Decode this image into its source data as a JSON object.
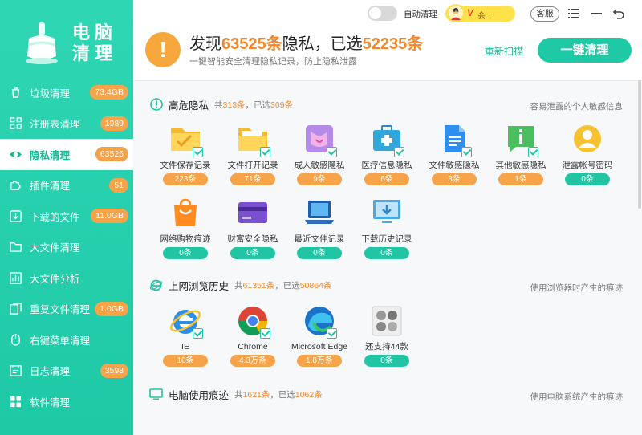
{
  "app": {
    "logo_text_1": "电脑",
    "logo_text_2": "清理"
  },
  "sidebar": {
    "items": [
      {
        "label": "垃圾清理",
        "badge": "73.4GB",
        "icon": "trash-icon"
      },
      {
        "label": "注册表清理",
        "badge": "1989",
        "icon": "registry-grid-icon"
      },
      {
        "label": "隐私清理",
        "badge": "63525",
        "icon": "eye-privacy-icon",
        "active": true
      },
      {
        "label": "插件清理",
        "badge": "51",
        "icon": "puzzle-plugin-icon"
      },
      {
        "label": "下载的文件",
        "badge": "11.0GB",
        "icon": "download-icon"
      },
      {
        "label": "大文件清理",
        "badge": "",
        "icon": "folder-icon"
      },
      {
        "label": "大文件分析",
        "badge": "",
        "icon": "chart-icon"
      },
      {
        "label": "重复文件清理",
        "badge": "1.0GB",
        "icon": "duplicate-file-icon"
      },
      {
        "label": "右键菜单清理",
        "badge": "",
        "icon": "mouse-icon"
      },
      {
        "label": "日志清理",
        "badge": "3598",
        "icon": "log-calendar-icon"
      },
      {
        "label": "软件清理",
        "badge": "",
        "icon": "apps-grid-icon"
      }
    ]
  },
  "topbar": {
    "auto_clean_label": "自动清理",
    "vip_v": "V",
    "vip_text": "会...",
    "service_label": "客服"
  },
  "header": {
    "title_prefix": "发现",
    "found_count": "63525条",
    "title_mid": "隐私，已选",
    "selected_count": "52235条",
    "subtitle": "一键智能安全清理隐私记录，防止隐私泄露",
    "rescan_label": "重新扫描",
    "clean_label": "一键清理"
  },
  "sections": {
    "high_risk": {
      "title": "高危隐私",
      "info_prefix": "共",
      "total": "313条",
      "info_mid": "，已选",
      "selected": "309条",
      "right_note": "容易泄露的个人敏感信息",
      "items": [
        {
          "label": "文件保存记录",
          "count": "223条",
          "color": "orange"
        },
        {
          "label": "文件打开记录",
          "count": "71条",
          "color": "orange"
        },
        {
          "label": "成人敏感隐私",
          "count": "9条",
          "color": "orange"
        },
        {
          "label": "医疗信息隐私",
          "count": "6条",
          "color": "orange"
        },
        {
          "label": "文件敏感隐私",
          "count": "3条",
          "color": "orange"
        },
        {
          "label": "其他敏感隐私",
          "count": "1条",
          "color": "orange"
        },
        {
          "label": "泄露帐号密码",
          "count": "0条",
          "color": "green"
        },
        {
          "label": "网络购物痕迹",
          "count": "0条",
          "color": "green"
        },
        {
          "label": "财富安全隐私",
          "count": "0条",
          "color": "green"
        },
        {
          "label": "最近文件记录",
          "count": "0条",
          "color": "green"
        },
        {
          "label": "下载历史记录",
          "count": "0条",
          "color": "green"
        }
      ]
    },
    "browser": {
      "title": "上网浏览历史",
      "info_prefix": "共",
      "total": "61351条",
      "info_mid": "，已选",
      "selected": "50864条",
      "right_note": "使用浏览器时产生的痕迹",
      "items": [
        {
          "label": "IE",
          "count": "10条",
          "color": "orange"
        },
        {
          "label": "Chrome",
          "count": "4.3万条",
          "color": "orange"
        },
        {
          "label": "Microsoft Edge",
          "count": "1.8万条",
          "color": "orange"
        },
        {
          "label": "还支持44款",
          "count": "0条",
          "color": "green"
        }
      ]
    },
    "pc_usage": {
      "title": "电脑使用痕迹",
      "info_prefix": "共",
      "total": "1621条",
      "info_mid": "，已选",
      "selected": "1062条",
      "right_note": "使用电脑系统产生的痕迹"
    }
  }
}
